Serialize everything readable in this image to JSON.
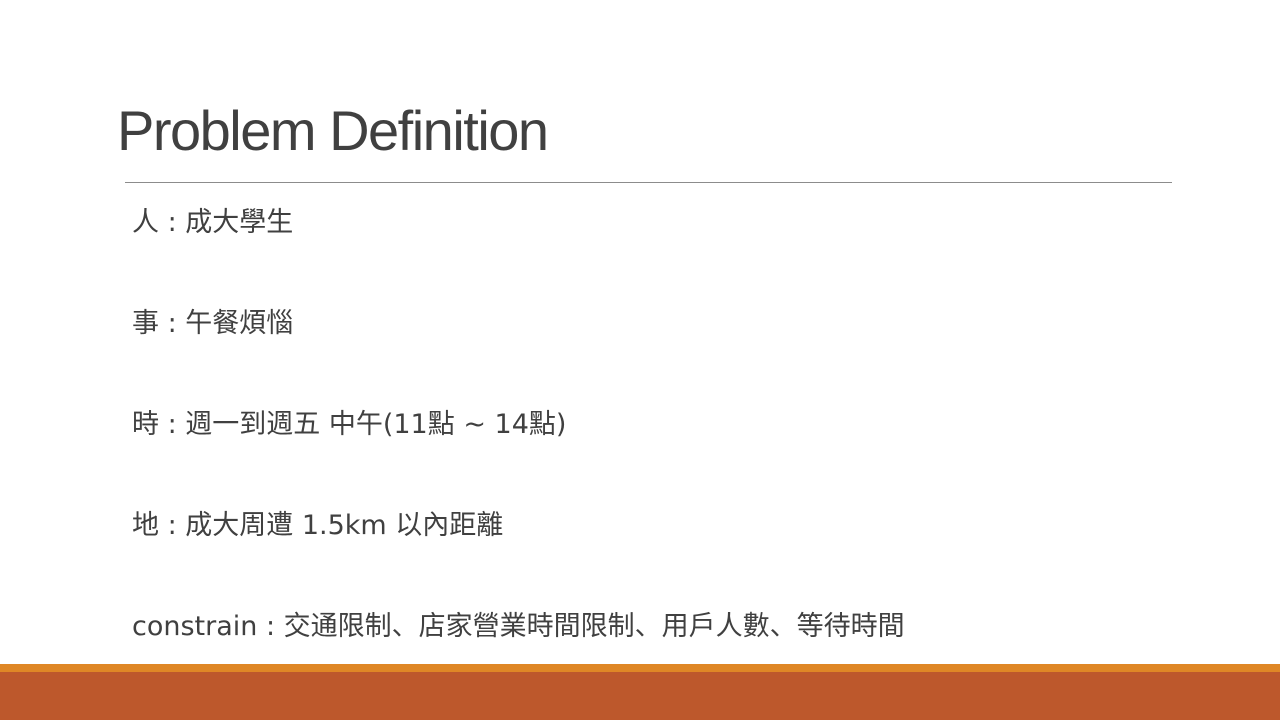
{
  "slide": {
    "title": "Problem Definition",
    "bullets": [
      "人 : 成大學生",
      "事 : 午餐煩惱",
      "時 : 週一到週五  中午(11點 ~ 14點)",
      "地 : 成大周遭 1.5km 以內距離",
      "constrain : 交通限制、店家營業時間限制、用戶人數、等待時間"
    ]
  },
  "colors": {
    "title_text": "#404040",
    "body_text": "#404040",
    "divider": "#8c8c8c",
    "footer_accent": "#df8726",
    "footer_band": "#bd582c"
  }
}
